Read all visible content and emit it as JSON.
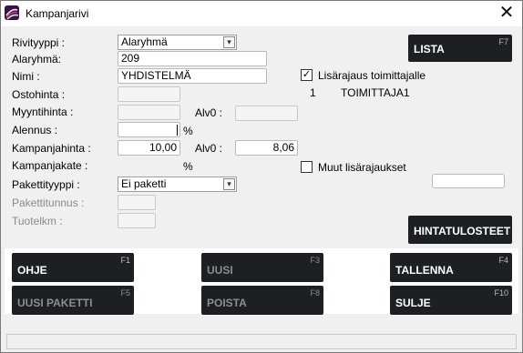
{
  "window": {
    "title": "Kampanjarivi",
    "close_glyph": "✕",
    "icon": "app-logo-icon"
  },
  "form": {
    "rivityyppi_label": "Rivityyppi :",
    "rivityyppi_value": "Alaryhmä",
    "alaryhma_label": "Alaryhmä:",
    "alaryhma_value": "209",
    "nimi_label": "Nimi :",
    "nimi_value": "YHDISTELMÄ",
    "ostohinta_label": "Ostohinta :",
    "ostohinta_value": "",
    "myyntihinta_label": "Myyntihinta :",
    "myyntihinta_value": "",
    "alv0_label_1": "Alv0 :",
    "alv0_value_1": "",
    "alennus_label": "Alennus :",
    "alennus_value": "",
    "alennus_unit": "%",
    "kampanjahinta_label": "Kampanjahinta :",
    "kampanjahinta_value": "10,00",
    "alv0_label_2": "Alv0 :",
    "alv0_value_2": "8,06",
    "kampanjakate_label": "Kampanjakate :",
    "kampanjakate_unit": "%",
    "pakettityyppi_label": "Pakettityyppi :",
    "pakettityyppi_value": "Ei paketti",
    "pakettitunnus_label": "Pakettitunnus :",
    "pakettitunnus_value": "",
    "tuotelkm_label": "Tuotelkm :",
    "tuotelkm_value": ""
  },
  "restrictions": {
    "supplier_checkbox_label": "Lisärajaus toimittajalle",
    "supplier_checked": true,
    "check_glyph": "✓",
    "supplier_number": "1",
    "supplier_name": "TOIMITTAJA1",
    "other_checkbox_label": "Muut lisärajaukset",
    "other_checked": false,
    "other_value": ""
  },
  "side_buttons": {
    "lista_label": "LISTA",
    "lista_key": "F7",
    "hintatulosteet_label": "HINTATULOSTEET"
  },
  "function_buttons": [
    {
      "label": "OHJE",
      "key": "F1",
      "enabled": true
    },
    {
      "label": "UUSI",
      "key": "F3",
      "enabled": false
    },
    {
      "label": "TALLENNA",
      "key": "F4",
      "enabled": true
    },
    {
      "label": "UUSI PAKETTI",
      "key": "F5",
      "enabled": false
    },
    {
      "label": "POISTA",
      "key": "F8",
      "enabled": false
    },
    {
      "label": "SULJE",
      "key": "F10",
      "enabled": true
    }
  ],
  "dropdown_arrow_glyph": "▾",
  "status": {
    "text": ""
  }
}
